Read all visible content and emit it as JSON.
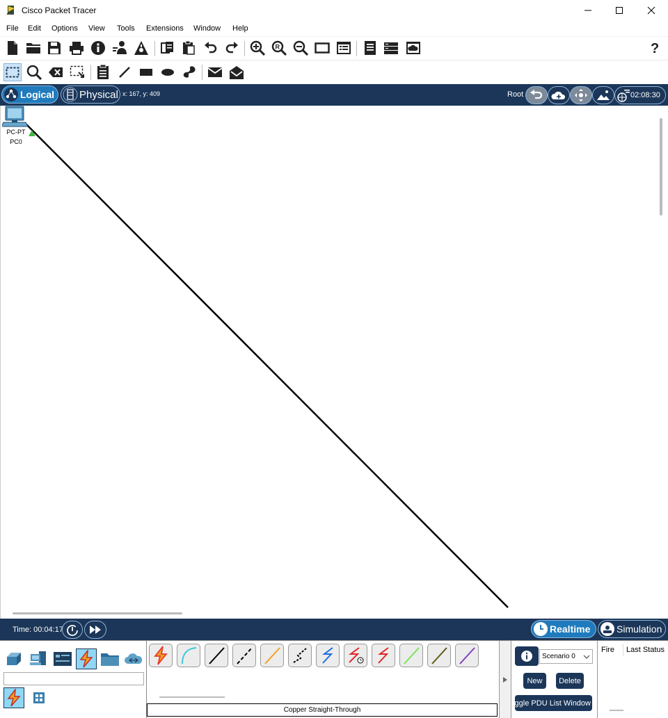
{
  "window": {
    "title": "Cisco Packet Tracer",
    "controls": [
      "minimize",
      "maximize",
      "close"
    ]
  },
  "menu": [
    "File",
    "Edit",
    "Options",
    "View",
    "Tools",
    "Extensions",
    "Window",
    "Help"
  ],
  "toolbar_main": [
    "new-file-icon",
    "open-folder-icon",
    "save-icon",
    "print-icon",
    "info-icon",
    "network-wizard-icon",
    "activity-wizard-icon",
    "copy-icon",
    "paste-icon",
    "undo-icon",
    "redo-icon",
    "zoom-in-icon",
    "zoom-reset-icon",
    "zoom-out-icon",
    "drawing-palette-icon",
    "custom-device-icon",
    "viewport-icon",
    "server-icon",
    "cloud-image-icon"
  ],
  "help_icon": "question-icon",
  "toolbar_tools": [
    "select-icon",
    "inspect-icon",
    "delete-icon",
    "resize-shape-icon",
    "note-icon",
    "line-icon",
    "rectangle-icon",
    "ellipse-icon",
    "freeform-icon",
    "simple-pdu-icon",
    "complex-pdu-icon"
  ],
  "modebar": {
    "logical_label": "Logical",
    "physical_label": "Physical",
    "coords": "x: 167, y: 409",
    "root_label": "Root",
    "clock": "02:08:30"
  },
  "workspace": {
    "device": {
      "type_label": "PC-PT",
      "name_label": "PC0",
      "icon": "pc-icon",
      "link_status_color": "#3fb83f"
    },
    "link_color": "#000000"
  },
  "timebar": {
    "time_label": "Time: 00:04:17",
    "realtime_label": "Realtime",
    "simulation_label": "Simulation"
  },
  "device_categories": [
    "network-devices-icon",
    "end-devices-icon",
    "components-icon",
    "connections-icon",
    "misc-icon",
    "multiuser-icon"
  ],
  "sub_categories": [
    "connections-sub-icon",
    "grid-sub-icon"
  ],
  "cables": [
    {
      "name": "automatic-cable",
      "color": "#e53b2c"
    },
    {
      "name": "console-cable",
      "color": "#35c7d9"
    },
    {
      "name": "copper-straight-through",
      "color": "#000000"
    },
    {
      "name": "copper-cross-over",
      "color": "#000000"
    },
    {
      "name": "fiber-cable",
      "color": "#f2a024"
    },
    {
      "name": "phone-cable",
      "color": "#000000"
    },
    {
      "name": "coaxial-cable",
      "color": "#1f6fe0"
    },
    {
      "name": "serial-dce-cable",
      "color": "#e0282a"
    },
    {
      "name": "serial-dte-cable",
      "color": "#e0282a"
    },
    {
      "name": "octal-cable",
      "color": "#7be35b"
    },
    {
      "name": "iot-custom-cable",
      "color": "#5c5c14"
    },
    {
      "name": "usb-cable",
      "color": "#7f3fbf"
    }
  ],
  "selected_cable_label": "Copper Straight-Through",
  "pdu_panel": {
    "scenario_value": "Scenario 0",
    "new_label": "New",
    "delete_label": "Delete",
    "toggle_label": "Toggle PDU List Window",
    "columns": [
      "Fire",
      "Last Status"
    ]
  }
}
